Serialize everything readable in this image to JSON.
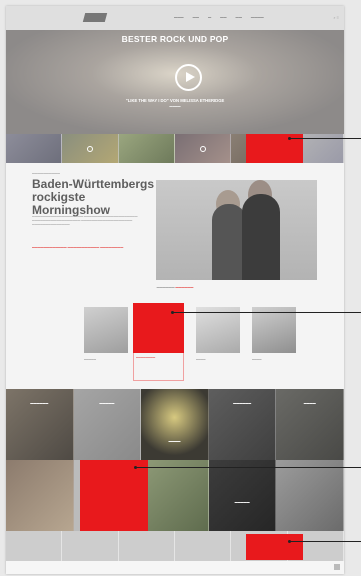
{
  "hero": {
    "title": "BESTER ROCK UND POP",
    "subtitle": "\"LIKE THE WAY I DO\" VON MELISSA ETHERIDGE"
  },
  "article": {
    "headline": "Baden-Württembergs rockigste Morningshow"
  },
  "colors": {
    "accent_red": "#e8191c",
    "panel_gray": "#f4f4f4",
    "text_gray": "#5e5e5e"
  }
}
